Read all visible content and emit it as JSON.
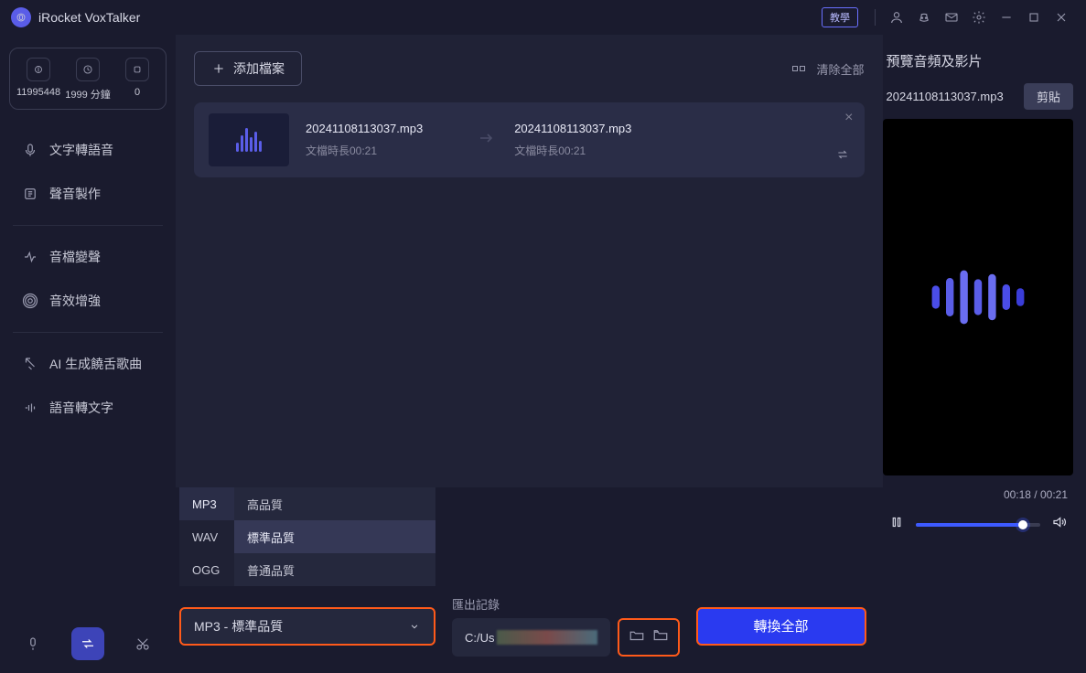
{
  "app": {
    "name": "iRocket VoxTalker"
  },
  "titlebar": {
    "teach": "教學"
  },
  "credits": {
    "c1": "11995448",
    "c2": "1999 分鐘",
    "c3": "0"
  },
  "nav": {
    "tts": "文字轉語音",
    "voice_make": "聲音製作",
    "voice_change": "音檔變聲",
    "enhance": "音效增強",
    "rap": "AI 生成饒舌歌曲",
    "stt": "語音轉文字"
  },
  "main": {
    "add": "添加檔案",
    "clear": "清除全部",
    "file": {
      "src_name": "20241108113037.mp3",
      "src_dur": "文檔時長00:21",
      "dst_name": "20241108113037.mp3",
      "dst_dur": "文檔時長00:21"
    }
  },
  "formats": {
    "mp3": "MP3",
    "wav": "WAV",
    "ogg": "OGG",
    "q_high": "高品質",
    "q_std": "標準品質",
    "q_low": "普通品質",
    "selected": "MP3 - 標準品質"
  },
  "export": {
    "label": "匯出記錄",
    "path": "C:/Us"
  },
  "convert": "轉換全部",
  "preview": {
    "title": "預覽音頻及影片",
    "fname": "20241108113037.mp3",
    "trim": "剪貼",
    "time": "00:18 / 00:21",
    "progress_pct": 86
  }
}
